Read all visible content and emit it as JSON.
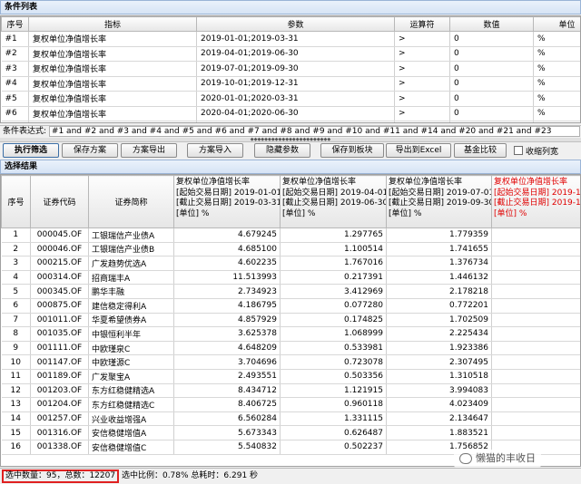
{
  "condition_list": {
    "title": "条件列表",
    "headers": [
      "序号",
      "指标",
      "参数",
      "运算符",
      "数值",
      "单位"
    ],
    "rows": [
      [
        "#1",
        "复权单位净值增长率",
        "2019-01-01;2019-03-31",
        ">",
        "0",
        "%"
      ],
      [
        "#2",
        "复权单位净值增长率",
        "2019-04-01;2019-06-30",
        ">",
        "0",
        "%"
      ],
      [
        "#3",
        "复权单位净值增长率",
        "2019-07-01;2019-09-30",
        ">",
        "0",
        "%"
      ],
      [
        "#4",
        "复权单位净值增长率",
        "2019-10-01;2019-12-31",
        ">",
        "0",
        "%"
      ],
      [
        "#5",
        "复权单位净值增长率",
        "2020-01-01;2020-03-31",
        ">",
        "0",
        "%"
      ],
      [
        "#6",
        "复权单位净值增长率",
        "2020-04-01;2020-06-30",
        ">",
        "0",
        "%"
      ],
      [
        "#7",
        "复权单位净值增长率",
        "2020-07-01;2020-09-30",
        ">",
        "0",
        "%"
      ]
    ]
  },
  "expression": {
    "label": "条件表达式:",
    "value": "#1 and #2 and #3 and #4 and #5 and #6 and #7 and #8 and #9 and #10 and #11 and #14 and #20 and #21 and #23"
  },
  "toolbar": {
    "run": "执行筛选",
    "save": "保存方案",
    "export_plan": "方案导出",
    "import_plan": "方案导入",
    "hide_params": "隐藏参数",
    "save_block": "保存到板块",
    "export_excel": "导出到Excel",
    "fund_compare": "基金比较",
    "collapse_cols": "收缩列宽"
  },
  "results": {
    "title": "选择结果",
    "headers": {
      "index": "序号",
      "code": "证券代码",
      "name": "证券简称",
      "cols": [
        [
          "复权单位净值增长率",
          "[起始交易日期] 2019-01-01",
          "[截止交易日期] 2019-03-31",
          "[单位] %"
        ],
        [
          "复权单位净值增长率",
          "[起始交易日期] 2019-04-01",
          "[截止交易日期] 2019-06-30",
          "[单位] %"
        ],
        [
          "复权单位净值增长率",
          "[起始交易日期] 2019-07-01",
          "[截止交易日期] 2019-09-30",
          "[单位] %"
        ],
        [
          "复权单位净值增长率",
          "[起始交易日期] 2019-10-0",
          "[截止交易日期] 2019-12-3",
          "[单位] %"
        ]
      ]
    },
    "rows": [
      [
        "1",
        "000045.OF",
        "工银瑞信产业债A",
        "4.679245",
        "1.297765",
        "1.779359",
        "2.237"
      ],
      [
        "2",
        "000046.OF",
        "工银瑞信产业债B",
        "4.685100",
        "1.100514",
        "1.741655",
        "2.139"
      ],
      [
        "3",
        "000215.OF",
        "广发趋势优选A",
        "4.602235",
        "1.767016",
        "1.376734",
        "3.006"
      ],
      [
        "4",
        "000314.OF",
        "招商瑞丰A",
        "11.513993",
        "0.217391",
        "1.446132",
        "2.423"
      ],
      [
        "5",
        "000345.OF",
        "鹏华丰融",
        "2.734923",
        "3.412969",
        "2.178218",
        "2.519"
      ],
      [
        "6",
        "000875.OF",
        "建信稳定得利A",
        "4.186795",
        "0.077280",
        "0.772201",
        "1.455"
      ],
      [
        "7",
        "001011.OF",
        "华夏希望债券A",
        "4.857929",
        "0.174825",
        "1.702509",
        "1.692"
      ],
      [
        "8",
        "001035.OF",
        "中银恒利半年",
        "3.625378",
        "1.068999",
        "2.225434",
        "1.329"
      ],
      [
        "9",
        "001111.OF",
        "中欧瑾泉C",
        "4.648209",
        "0.533981",
        "1.923386",
        "2.416"
      ],
      [
        "10",
        "001147.OF",
        "中欧瑾源C",
        "3.704696",
        "0.723078",
        "2.307495",
        "3.014"
      ],
      [
        "11",
        "001189.OF",
        "广发聚宝A",
        "2.493551",
        "0.503356",
        "1.310518",
        "2.545"
      ],
      [
        "12",
        "001203.OF",
        "东方红稳健精选A",
        "8.434712",
        "1.121915",
        "3.994083",
        "3.413"
      ],
      [
        "13",
        "001204.OF",
        "东方红稳健精选C",
        "8.406725",
        "0.960118",
        "4.023409",
        "3.234"
      ],
      [
        "14",
        "001257.OF",
        "兴业收益增强A",
        "6.560284",
        "1.331115",
        "2.134647",
        "2.813"
      ],
      [
        "15",
        "001316.OF",
        "安信稳健增值A",
        "5.673343",
        "0.626487",
        "1.883521",
        "2.823"
      ],
      [
        "16",
        "001338.OF",
        "安信稳健增值C",
        "5.540832",
        "0.502237",
        "1.756852",
        "2.701"
      ]
    ]
  },
  "status": {
    "count": "选中数量：95，总数：12207",
    "ratio": "选中比例：0.78% 总耗时：6.291 秒"
  },
  "watermark": "懒猫的丰收日"
}
